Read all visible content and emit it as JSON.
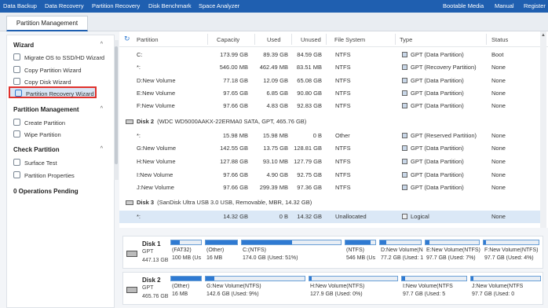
{
  "menu": {
    "left": [
      "Data Backup",
      "Data Recovery",
      "Partition Recovery",
      "Disk Benchmark",
      "Space Analyzer"
    ],
    "right": [
      "Bootable Media",
      "Manual",
      "Register"
    ]
  },
  "tab": {
    "label": "Partition Management"
  },
  "sidebar": {
    "wizard": {
      "title": "Wizard",
      "items": [
        "Migrate OS to SSD/HD Wizard",
        "Copy Partition Wizard",
        "Copy Disk Wizard",
        "Partition Recovery Wizard"
      ]
    },
    "partition_management": {
      "title": "Partition Management",
      "items": [
        "Create Partition",
        "Wipe Partition"
      ]
    },
    "check_partition": {
      "title": "Check Partition",
      "items": [
        "Surface Test",
        "Partition Properties"
      ]
    },
    "operations": "0 Operations Pending"
  },
  "table": {
    "headers": [
      "Partition",
      "Capacity",
      "Used",
      "Unused",
      "File System",
      "Type",
      "Status"
    ],
    "disk1_rows": [
      [
        "C:",
        "173.99 GB",
        "89.39 GB",
        "84.59 GB",
        "NTFS",
        "GPT (Data Partition)",
        "Boot"
      ],
      [
        "*:",
        "546.00 MB",
        "462.49 MB",
        "83.51 MB",
        "NTFS",
        "GPT (Recovery Partition)",
        "None"
      ],
      [
        "D:New Volume",
        "77.18 GB",
        "12.09 GB",
        "65.08 GB",
        "NTFS",
        "GPT (Data Partition)",
        "None"
      ],
      [
        "E:New Volume",
        "97.65 GB",
        "6.85 GB",
        "90.80 GB",
        "NTFS",
        "GPT (Data Partition)",
        "None"
      ],
      [
        "F:New Volume",
        "97.66 GB",
        "4.83 GB",
        "92.83 GB",
        "NTFS",
        "GPT (Data Partition)",
        "None"
      ]
    ],
    "disk2": {
      "name": "Disk 2",
      "detail": "(WDC WD5000AAKX-22ERMA0 SATA, GPT, 465.76 GB)"
    },
    "disk2_rows": [
      [
        "*:",
        "15.98 MB",
        "15.98 MB",
        "0 B",
        "Other",
        "GPT (Reserved Partition)",
        "None"
      ],
      [
        "G:New Volume",
        "142.55 GB",
        "13.75 GB",
        "128.81 GB",
        "NTFS",
        "GPT (Data Partition)",
        "None"
      ],
      [
        "H:New Volume",
        "127.88 GB",
        "93.10 MB",
        "127.79 GB",
        "NTFS",
        "GPT (Data Partition)",
        "None"
      ],
      [
        "I:New Volume",
        "97.66 GB",
        "4.90 GB",
        "92.75 GB",
        "NTFS",
        "GPT (Data Partition)",
        "None"
      ],
      [
        "J:New Volume",
        "97.66 GB",
        "299.39 MB",
        "97.36 GB",
        "NTFS",
        "GPT (Data Partition)",
        "None"
      ]
    ],
    "disk3": {
      "name": "Disk 3",
      "detail": "(SanDisk Ultra USB 3.0 USB, Removable, MBR, 14.32 GB)"
    },
    "disk3_rows": [
      [
        "*:",
        "14.32 GB",
        "0 B",
        "14.32 GB",
        "Unallocated",
        "Logical",
        "None"
      ]
    ]
  },
  "diskmap": {
    "disk1": {
      "name": "Disk 1",
      "type": "GPT",
      "size": "447.13 GB",
      "parts": [
        {
          "l1": "(FAT32)",
          "l2": "100 MB (Us",
          "used": 0.3
        },
        {
          "l1": "(Other)",
          "l2": "16 MB",
          "used": 1.0
        },
        {
          "l1": "C:(NTFS)",
          "l2": "174.0 GB (Used: 51%)",
          "used": 0.51
        },
        {
          "l1": "(NTFS)",
          "l2": "546 MB (Us",
          "used": 0.85
        },
        {
          "l1": "D:New Volume(N",
          "l2": "77.2 GB (Used: 1",
          "used": 0.16
        },
        {
          "l1": "E:New Volume(NTFS)",
          "l2": "97.7 GB (Used: 7%)",
          "used": 0.07
        },
        {
          "l1": "F:New Volume(NTFS)",
          "l2": "97.7 GB (Used: 4%)",
          "used": 0.04
        }
      ]
    },
    "disk2": {
      "name": "Disk 2",
      "type": "GPT",
      "size": "465.76 GB",
      "parts": [
        {
          "l1": "(Other)",
          "l2": "16 MB",
          "used": 1.0
        },
        {
          "l1": "G:New Volume(NTFS)",
          "l2": "142.6 GB (Used: 9%)",
          "used": 0.09
        },
        {
          "l1": "H:New Volume(NTFS)",
          "l2": "127.9 GB (Used: 0%)",
          "used": 0.0
        },
        {
          "l1": "I:New Volume(NTFS",
          "l2": "97.7 GB (Used: 5",
          "used": 0.05
        },
        {
          "l1": "J:New Volume(NTFS",
          "l2": "97.7 GB (Used: 0",
          "used": 0.0
        }
      ]
    }
  },
  "colors": {
    "menu_bar": "#1f5fb0",
    "selection": "#dbe8f6",
    "highlight_border": "#e0312c",
    "partition_fill": "#2f7ad2"
  }
}
